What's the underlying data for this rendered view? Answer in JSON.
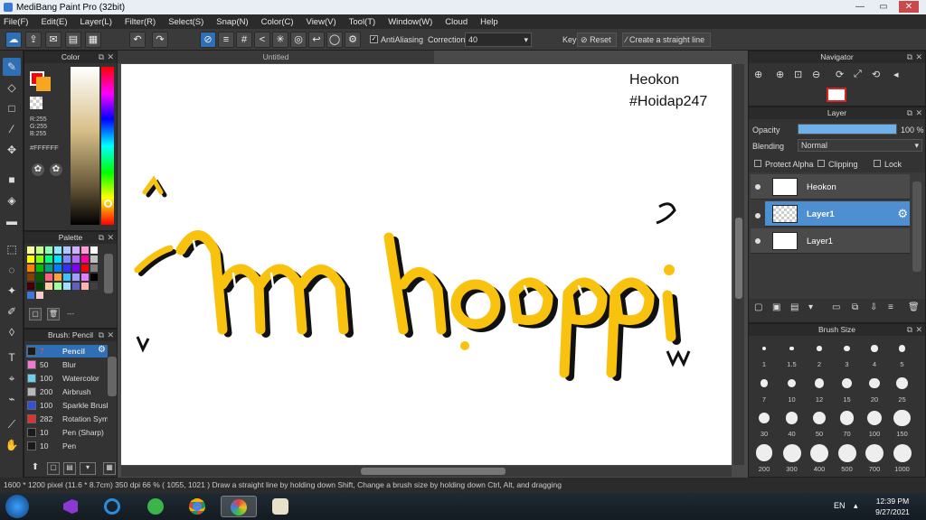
{
  "window": {
    "title": "MediBang Paint Pro (32bit)",
    "controls": [
      "—",
      "▭",
      "✕"
    ]
  },
  "menu": [
    "File(F)",
    "Edit(E)",
    "Layer(L)",
    "Filter(R)",
    "Select(S)",
    "Snap(N)",
    "Color(C)",
    "View(V)",
    "Tool(T)",
    "Window(W)",
    "Cloud",
    "Help"
  ],
  "toolbar": {
    "antialiasing_label": "AntiAliasing",
    "antialiasing_checked": true,
    "correction_label": "Correction",
    "correction_value": "40",
    "key_label": "Key",
    "reset_label": "Reset",
    "straight_line_label": "Create a straight line"
  },
  "color_panel": {
    "title": "Color",
    "r": "R:255",
    "g": "G:255",
    "b": "B:255",
    "hex": "#FFFFFF",
    "foreground": "#ff0000",
    "secondary": "#f5a623"
  },
  "palette_panel": {
    "title": "Palette",
    "swatches": [
      "#fbff9c",
      "#c8ff8c",
      "#8cffb4",
      "#8ceaff",
      "#b0c6ff",
      "#d0b0ff",
      "#ff9cd6",
      "#ffffff",
      "#ffff00",
      "#80ff00",
      "#00ff80",
      "#00e5ff",
      "#7f8cff",
      "#b06cff",
      "#ff00a0",
      "#c0c0c0",
      "#ff8000",
      "#00c000",
      "#00a080",
      "#0080ff",
      "#3030ff",
      "#8000ff",
      "#ff0000",
      "#808080",
      "#804000",
      "#006000",
      "#ff6080",
      "#ffa040",
      "#40c0ff",
      "#a0a0ff",
      "#e080ff",
      "#000000",
      "#400000",
      "#004000",
      "#ffd0a0",
      "#a0ffa0",
      "#a0e0ff",
      "#6060c0",
      "#ffb0b0",
      "#404040",
      "#3c78d8",
      "#f4cccc"
    ],
    "footer_text": "---"
  },
  "brush_panel": {
    "title": "Brush: Pencil",
    "brushes": [
      {
        "size": "7",
        "name": "Pencil",
        "color": "#1a1a1a",
        "active": true
      },
      {
        "size": "50",
        "name": "Blur",
        "color": "#f07ad0",
        "active": false
      },
      {
        "size": "100",
        "name": "Watercolor",
        "color": "#6ad0f0",
        "active": false
      },
      {
        "size": "200",
        "name": "Airbrush",
        "color": "#b8b8b8",
        "active": false
      },
      {
        "size": "100",
        "name": "Sparkle Brush",
        "color": "#3050e0",
        "active": false
      },
      {
        "size": "282",
        "name": "Rotation Sym",
        "color": "#e03030",
        "active": false
      },
      {
        "size": "10",
        "name": "Pen (Sharp)",
        "color": "#1a1a1a",
        "active": false
      },
      {
        "size": "10",
        "name": "Pen",
        "color": "#1a1a1a",
        "active": false
      }
    ]
  },
  "document": {
    "tab_title": "Untitled",
    "text_heokon": "Heokon",
    "text_hashtag": "#Hoidap247",
    "lettering": "Ăm hạp pi"
  },
  "navigator": {
    "title": "Navigator"
  },
  "layer_panel": {
    "title": "Layer",
    "opacity_label": "Opacity",
    "opacity_value": "100 %",
    "opacity_fraction": 1.0,
    "blending_label": "Blending",
    "blending_value": "Normal",
    "protect_alpha_label": "Protect Alpha",
    "clipping_label": "Clipping",
    "lock_label": "Lock",
    "layers": [
      {
        "name": "Heokon",
        "active": false
      },
      {
        "name": "Layer1",
        "active": true
      },
      {
        "name": "Layer1",
        "active": false
      }
    ]
  },
  "brush_size_panel": {
    "title": "Brush Size",
    "sizes": [
      "1",
      "1.5",
      "2",
      "3",
      "4",
      "5",
      "7",
      "10",
      "12",
      "15",
      "20",
      "25",
      "30",
      "40",
      "50",
      "70",
      "100",
      "150",
      "200",
      "300",
      "400",
      "500",
      "700",
      "1000"
    ]
  },
  "status": {
    "text": "1600 * 1200 pixel  (11.6 * 8.7cm)  350 dpi  66 %  ( 1055, 1021 )  Draw a straight line by holding down Shift, Change a brush size by holding down Ctrl, Alt, and dragging"
  },
  "taskbar": {
    "lang": "EN",
    "time": "12:39 PM",
    "date": "9/27/2021"
  }
}
